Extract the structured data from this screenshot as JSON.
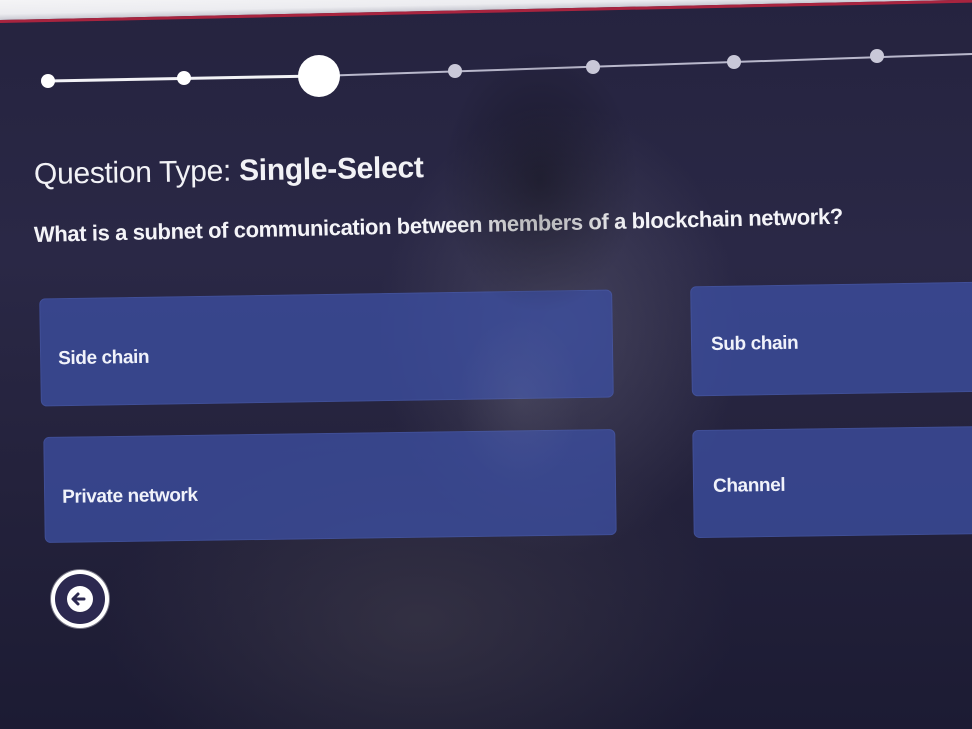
{
  "progress": {
    "total_steps": 7,
    "current_step": 3
  },
  "header": {
    "question_type_prefix": "Question Type: ",
    "question_type_value": "Single-Select"
  },
  "question": {
    "text": "What is a subnet of communication between members of a blockchain network?"
  },
  "options": [
    {
      "label": "Side chain"
    },
    {
      "label": "Sub chain"
    },
    {
      "label": "Private network"
    },
    {
      "label": "Channel"
    }
  ],
  "navigation": {
    "back_icon": "arrow-left-icon"
  },
  "colors": {
    "background": "#25233f",
    "option_fill": "#3c4ea0",
    "accent_line": "#a8243f",
    "text": "#f2f2f6"
  }
}
